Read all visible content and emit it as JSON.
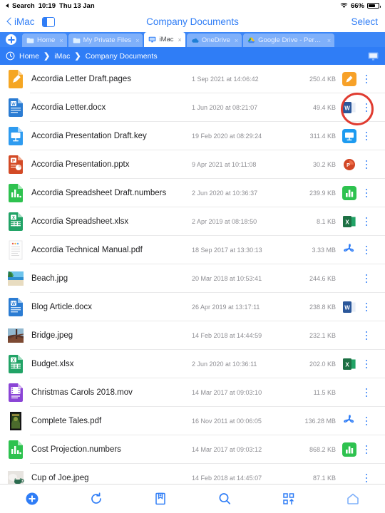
{
  "statusbar": {
    "back_app": "Search",
    "time": "10:19",
    "date": "Thu 13 Jan",
    "battery": "66%",
    "wifi_icon": "wifi-icon",
    "battery_icon": "battery-icon"
  },
  "navbar": {
    "back_label": "iMac",
    "sidebar_icon": "sidebar-toggle-icon",
    "title": "Company Documents",
    "select_label": "Select"
  },
  "tabs": {
    "add_icon": "plus-circle-icon",
    "items": [
      {
        "label": "Home",
        "icon": "folder-icon",
        "active": false,
        "close": "×"
      },
      {
        "label": "My Private Files",
        "icon": "folder-icon",
        "active": false,
        "close": "×"
      },
      {
        "label": "iMac",
        "icon": "display-icon",
        "active": true,
        "close": "×"
      },
      {
        "label": "OneDrive",
        "icon": "onedrive-icon",
        "active": false,
        "close": "×"
      },
      {
        "label": "Google Drive - Personal",
        "icon": "google-drive-icon",
        "active": false,
        "close": "×"
      }
    ]
  },
  "breadcrumb": {
    "history_icon": "history-clock-icon",
    "items": [
      "Home",
      "iMac",
      "Company Documents"
    ],
    "separator": "❯",
    "right_icon": "display-icon"
  },
  "files": [
    {
      "name": "Accordia Letter Draft.pages",
      "date": "1 Sep 2021 at 14:06:42",
      "size": "250.4 KB",
      "icon": "pages-file-icon",
      "app": "pages-app-icon"
    },
    {
      "name": "Accordia Letter.docx",
      "date": "1 Jun 2020 at 08:21:07",
      "size": "49.4 KB",
      "icon": "word-file-icon",
      "app": "word-app-icon"
    },
    {
      "name": "Accordia Presentation Draft.key",
      "date": "19 Feb 2020 at 08:29:24",
      "size": "311.4 KB",
      "icon": "keynote-file-icon",
      "app": "keynote-app-icon"
    },
    {
      "name": "Accordia Presentation.pptx",
      "date": "9 Apr 2021 at 10:11:08",
      "size": "30.2 KB",
      "icon": "powerpoint-file-icon",
      "app": "powerpoint-app-icon"
    },
    {
      "name": "Accordia Spreadsheet Draft.numbers",
      "date": "2 Jun 2020 at 10:36:37",
      "size": "239.9 KB",
      "icon": "numbers-file-icon",
      "app": "numbers-app-icon"
    },
    {
      "name": "Accordia Spreadsheet.xlsx",
      "date": "2 Apr 2019 at 08:18:50",
      "size": "8.1 KB",
      "icon": "excel-file-icon",
      "app": "excel-app-icon"
    },
    {
      "name": "Accordia Technical Manual.pdf",
      "date": "18 Sep 2017 at 13:30:13",
      "size": "3.33 MB",
      "icon": "pdf-preview-icon",
      "app": "acrobat-app-icon"
    },
    {
      "name": "Beach.jpg",
      "date": "20 Mar 2018 at 10:53:41",
      "size": "244.6 KB",
      "icon": "beach-photo-thumbnail",
      "app": ""
    },
    {
      "name": "Blog Article.docx",
      "date": "26 Apr 2019 at 13:17:11",
      "size": "238.8 KB",
      "icon": "word-file-icon",
      "app": "word-app-icon"
    },
    {
      "name": "Bridge.jpeg",
      "date": "14 Feb 2018 at 14:44:59",
      "size": "232.1 KB",
      "icon": "bridge-photo-thumbnail",
      "app": ""
    },
    {
      "name": "Budget.xlsx",
      "date": "2 Jun 2020 at 10:36:11",
      "size": "202.0 KB",
      "icon": "excel-file-icon",
      "app": "excel-app-icon"
    },
    {
      "name": "Christmas Carols 2018.mov",
      "date": "14 Mar 2017 at 09:03:10",
      "size": "11.5 KB",
      "icon": "movie-file-icon",
      "app": ""
    },
    {
      "name": "Complete Tales.pdf",
      "date": "16 Nov 2011 at 00:06:05",
      "size": "136.28 MB",
      "icon": "book-cover-thumbnail",
      "app": "acrobat-app-icon"
    },
    {
      "name": "Cost Projection.numbers",
      "date": "14 Mar 2017 at 09:03:12",
      "size": "868.2 KB",
      "icon": "numbers-file-icon",
      "app": "numbers-app-icon"
    },
    {
      "name": "Cup of Joe.jpeg",
      "date": "14 Feb 2018 at 14:45:07",
      "size": "87.1 KB",
      "icon": "coffee-photo-thumbnail",
      "app": ""
    }
  ],
  "annotation": {
    "type": "red-circle-highlight",
    "target": "word-app-icon on row Accordia Letter.docx",
    "color": "#e03c31"
  },
  "toolbar": {
    "items": [
      {
        "icon": "add-circle-icon"
      },
      {
        "icon": "refresh-icon"
      },
      {
        "icon": "bookmark-add-icon"
      },
      {
        "icon": "search-icon"
      },
      {
        "icon": "sort-icon"
      },
      {
        "icon": "home-icon"
      }
    ]
  },
  "colors": {
    "accent": "#2f7df6",
    "tabbar": "#3b86f7",
    "annotation": "#e03c31"
  }
}
